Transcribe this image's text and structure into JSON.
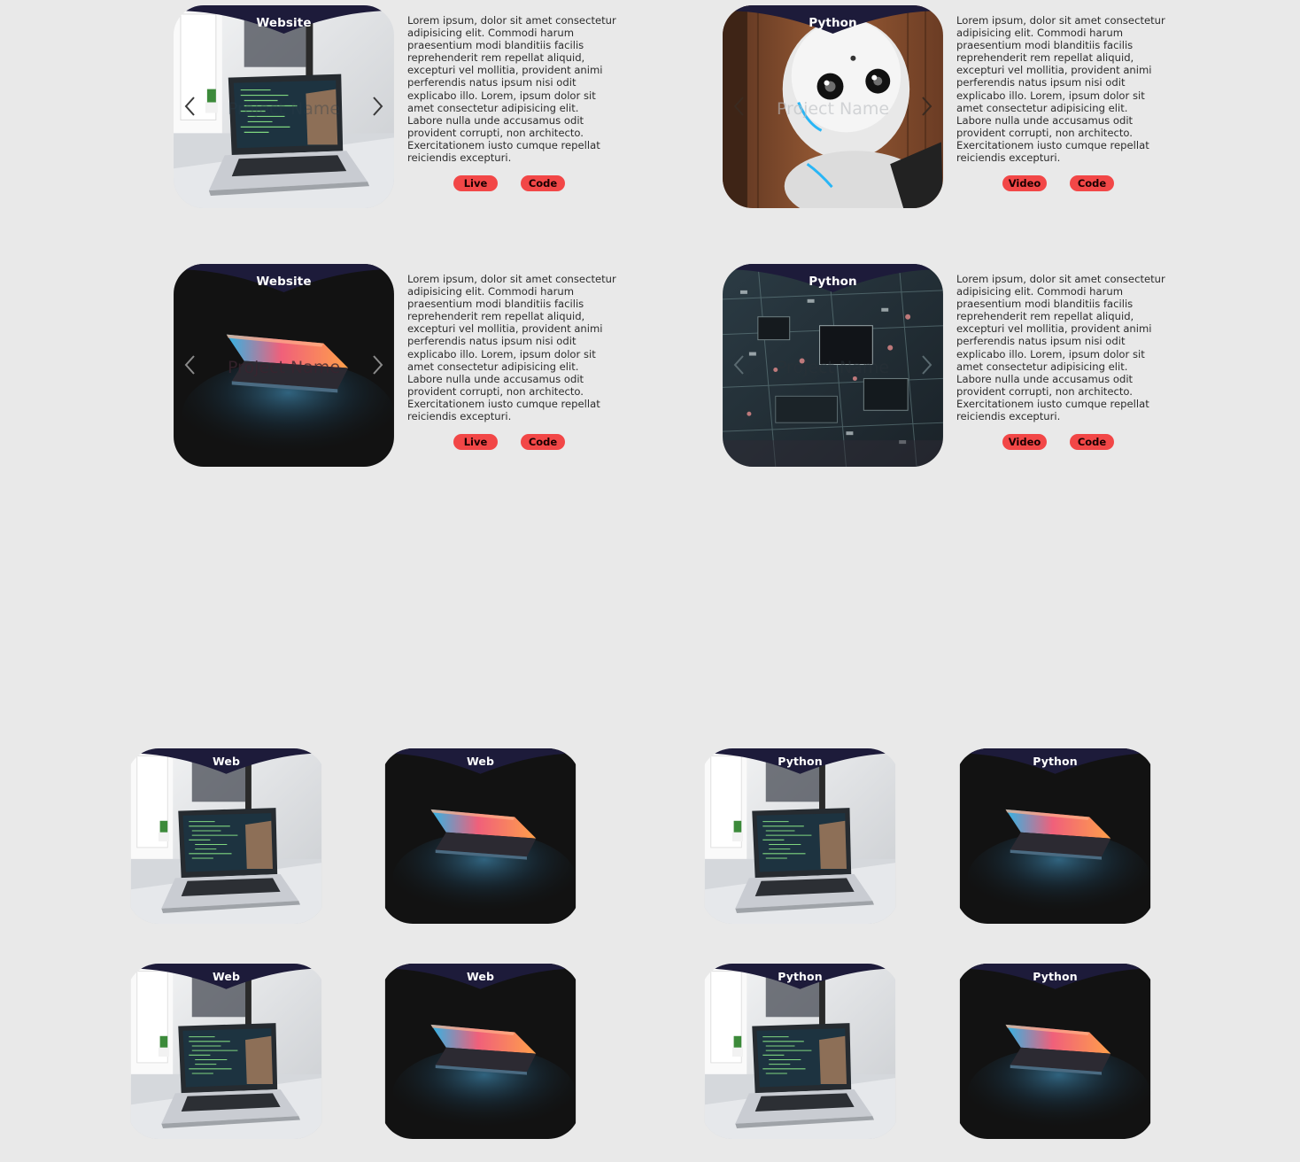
{
  "featured": [
    {
      "category": "Website",
      "image": "laptop-desk-photo",
      "title": "Project Name",
      "description": "Lorem ipsum, dolor sit amet consectetur adipisicing elit. Commodi harum praesentium modi blanditiis facilis reprehenderit rem repellat aliquid, excepturi vel mollitia, provident animi perferendis natus ipsum nisi odit explicabo illo. Lorem, ipsum dolor sit amet consectetur adipisicing elit. Labore nulla unde accusamus odit provident corrupti, non architecto. Exercitationem iusto cumque repellat reiciendis excepturi.",
      "buttons": [
        "Live",
        "Code"
      ]
    },
    {
      "category": "Python",
      "image": "robot-photo",
      "title": "Project Name",
      "description": "Lorem ipsum, dolor sit amet consectetur adipisicing elit. Commodi harum praesentium modi blanditiis facilis reprehenderit rem repellat aliquid, excepturi vel mollitia, provident animi perferendis natus ipsum nisi odit explicabo illo. Lorem, ipsum dolor sit amet consectetur adipisicing elit. Labore nulla unde accusamus odit provident corrupti, non architecto. Exercitationem iusto cumque repellat reiciendis excepturi.",
      "buttons": [
        "Video",
        "Code"
      ]
    },
    {
      "category": "Website",
      "image": "dark-laptop-photo",
      "title": "Project Name",
      "description": "Lorem ipsum, dolor sit amet consectetur adipisicing elit. Commodi harum praesentium modi blanditiis facilis reprehenderit rem repellat aliquid, excepturi vel mollitia, provident animi perferendis natus ipsum nisi odit explicabo illo. Lorem, ipsum dolor sit amet consectetur adipisicing elit. Labore nulla unde accusamus odit provident corrupti, non architecto. Exercitationem iusto cumque repellat reiciendis excepturi.",
      "buttons": [
        "Live",
        "Code"
      ]
    },
    {
      "category": "Python",
      "image": "circuit-board-photo",
      "title": "Project Name",
      "description": "Lorem ipsum, dolor sit amet consectetur adipisicing elit. Commodi harum praesentium modi blanditiis facilis reprehenderit rem repellat aliquid, excepturi vel mollitia, provident animi perferendis natus ipsum nisi odit explicabo illo. Lorem, ipsum dolor sit amet consectetur adipisicing elit. Labore nulla unde accusamus odit provident corrupti, non architecto. Exercitationem iusto cumque repellat reiciendis excepturi.",
      "buttons": [
        "Video",
        "Code"
      ]
    }
  ],
  "grid": [
    {
      "category": "Web",
      "image": "laptop-desk-photo"
    },
    {
      "category": "Web",
      "image": "dark-laptop-photo"
    },
    {
      "category": "Python",
      "image": "laptop-desk-photo"
    },
    {
      "category": "Python",
      "image": "dark-laptop-photo"
    },
    {
      "category": "Web",
      "image": "laptop-desk-photo"
    },
    {
      "category": "Web",
      "image": "dark-laptop-photo"
    },
    {
      "category": "Python",
      "image": "laptop-desk-photo"
    },
    {
      "category": "Python",
      "image": "dark-laptop-photo"
    }
  ],
  "colors": {
    "background": "#e9e9e9",
    "wave": "#1d1b3a",
    "button": "#f24747",
    "label": "#ffffff"
  },
  "icons": {
    "prev": "chevron-left-icon",
    "next": "chevron-right-icon"
  }
}
